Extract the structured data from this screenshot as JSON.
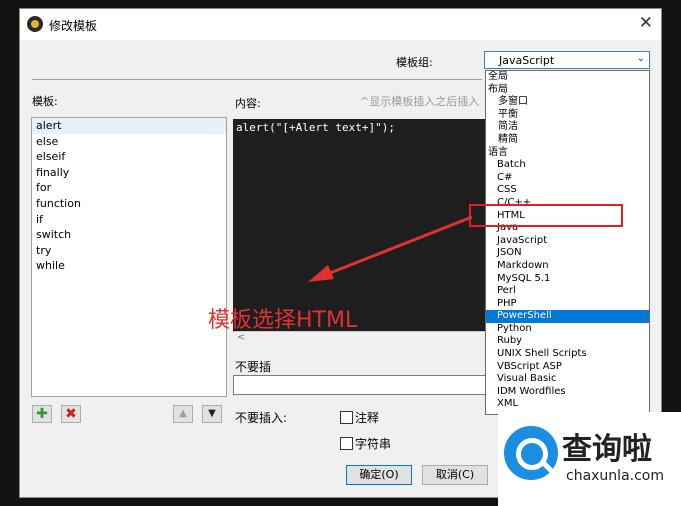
{
  "window": {
    "title": "修改模板",
    "close_glyph": "✕"
  },
  "template_group": {
    "label": "模板组:",
    "selected": "JavaScript",
    "options": [
      "全局",
      "布局",
      "多窗口",
      "平衡",
      "简洁",
      "精简",
      "语言",
      "Batch",
      "C#",
      "CSS",
      "C/C++",
      "HTML",
      "Java",
      "JavaScript",
      "JSON",
      "Markdown",
      "MySQL 5.1",
      "Perl",
      "PHP",
      "PowerShell",
      "Python",
      "Ruby",
      "UNIX Shell Scripts",
      "VBScript ASP",
      "Visual Basic",
      "IDM Wordfiles",
      "XML"
    ],
    "highlighted": "PowerShell"
  },
  "templates": {
    "label": "模板:",
    "items": [
      "alert",
      "else",
      "elseif",
      "finally",
      "for",
      "function",
      "if",
      "switch",
      "try",
      "while"
    ],
    "selected": "alert"
  },
  "content": {
    "label": "内容:",
    "hint": "^显示模板插入之后插入",
    "code": "alert(\"[+Alert text+]\");",
    "scroll_left": "<"
  },
  "no_insert": {
    "label": "不要插",
    "value": "",
    "options_label": "不要插入:",
    "checkbox_comment": "注释",
    "checkbox_string": "字符串"
  },
  "buttons": {
    "ok": "确定(O)",
    "cancel": "取消(C)"
  },
  "toolbar": {
    "add_glyph": "✚",
    "delete_glyph": "✖",
    "up_glyph": "▲",
    "down_glyph": "▼"
  },
  "annotation": {
    "text": "模板选择HTML",
    "color": "#e03030"
  },
  "watermark": {
    "title": "查询啦",
    "url": "chaxunla.com"
  },
  "colors": {
    "accent": "#0078d7",
    "annotation": "#e03030"
  }
}
